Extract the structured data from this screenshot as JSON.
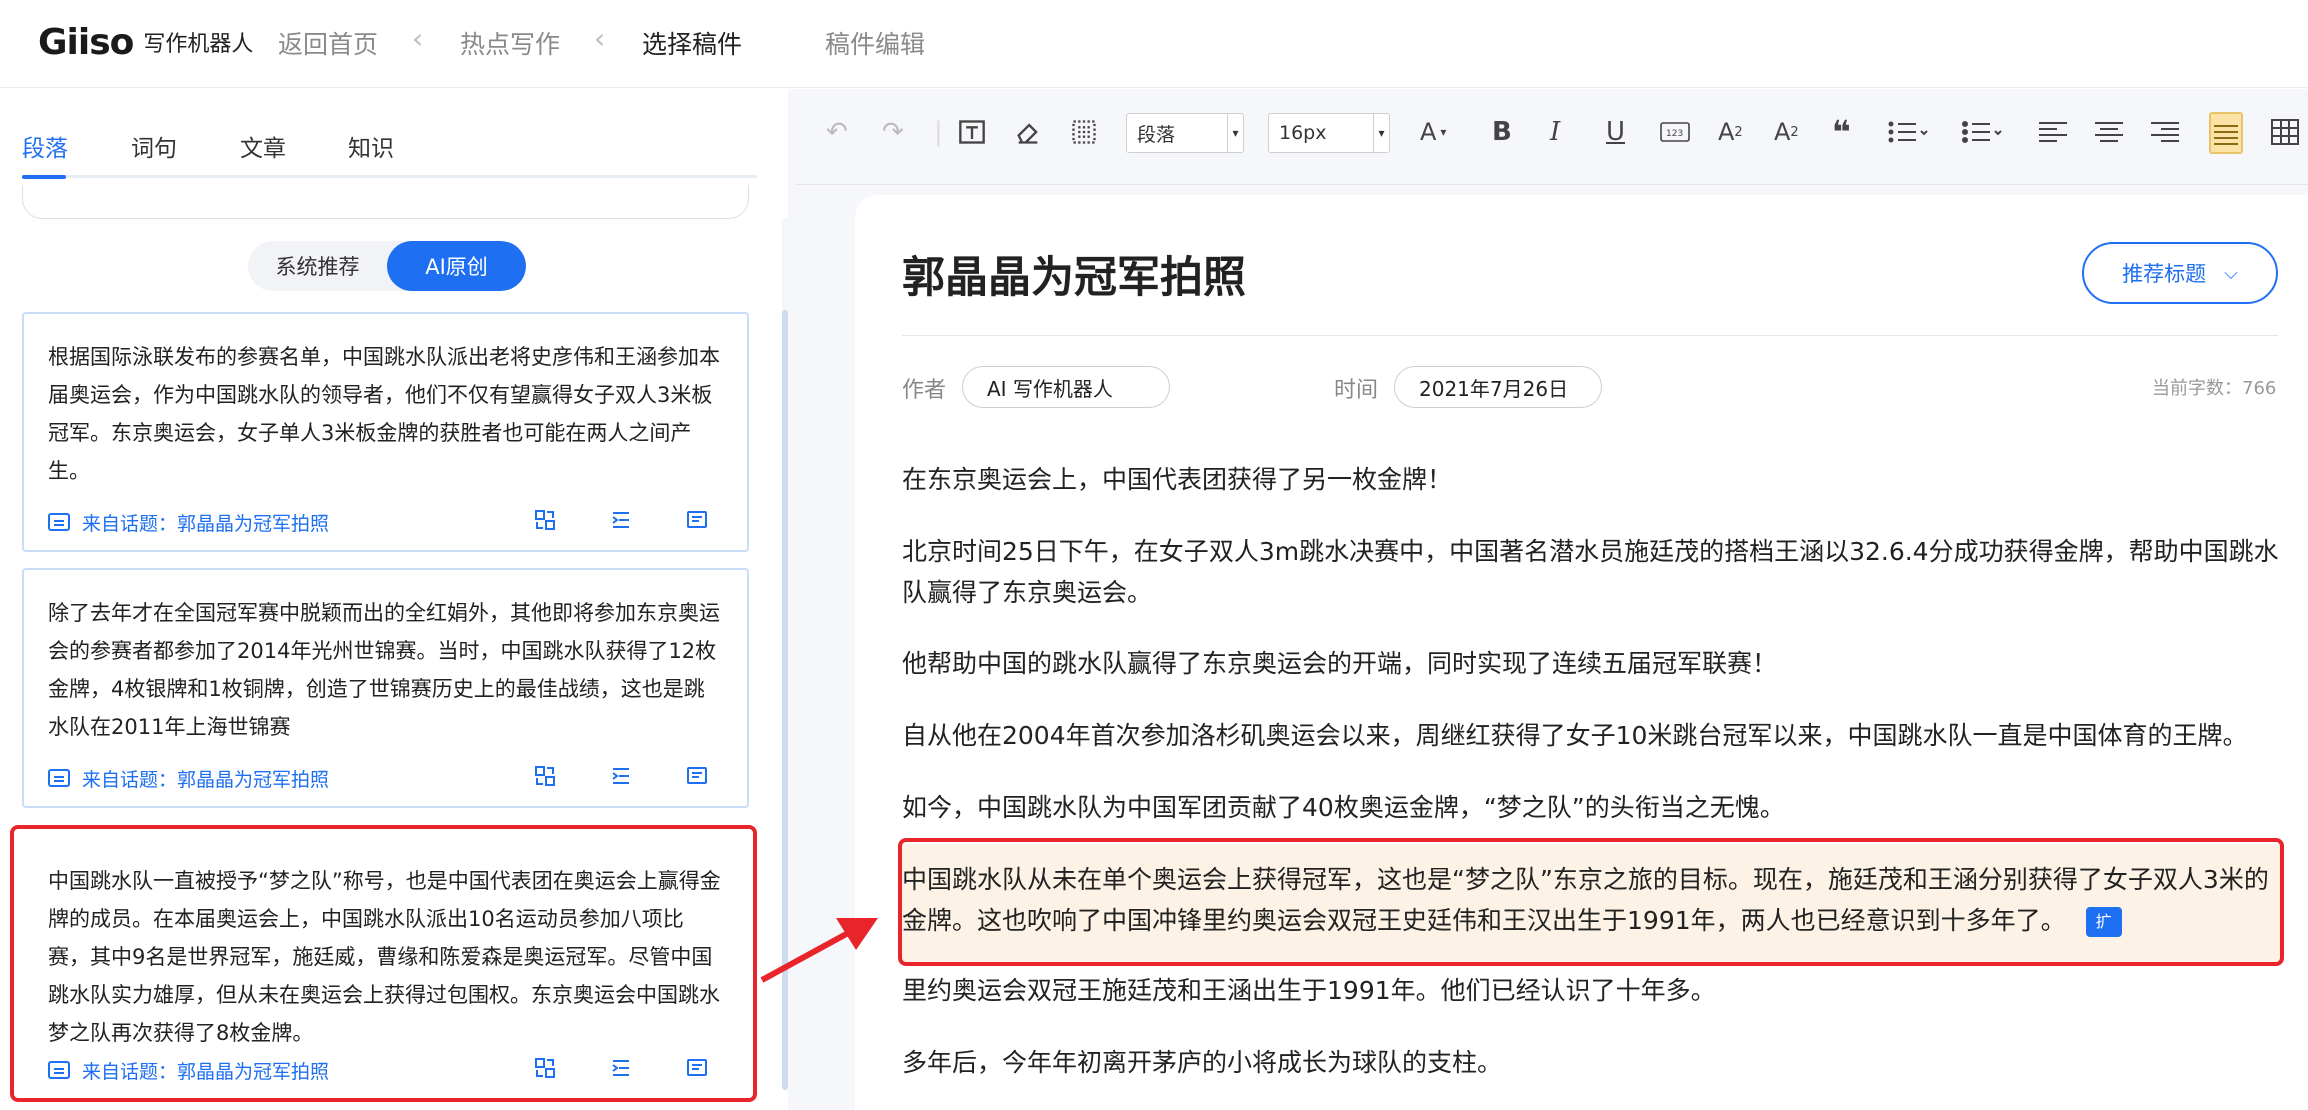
{
  "app": {
    "logo": "Giiso",
    "logo_subtitle": "写作机器人"
  },
  "nav": {
    "home": "返回首页",
    "hot_writing": "热点写作",
    "select_draft": "选择稿件",
    "edit_draft": "稿件编辑"
  },
  "left": {
    "tabs": [
      "段落",
      "词句",
      "文章",
      "知识"
    ],
    "active_tab": "段落",
    "segment": {
      "options": [
        "系统推荐",
        "AI原创"
      ],
      "active": "AI原创"
    },
    "cards": [
      {
        "text": "根据国际泳联发布的参赛名单，中国跳水队派出老将史彦伟和王涵参加本届奥运会，作为中国跳水队的领导者，他们不仅有望赢得女子双人3米板冠军。东京奥运会，女子单人3米板金牌的获胜者也可能在两人之间产生。",
        "source": "来自话题：郭晶晶为冠军拍照"
      },
      {
        "text": "除了去年才在全国冠军赛中脱颖而出的全红娟外，其他即将参加东京奥运会的参赛者都参加了2014年光州世锦赛。当时，中国跳水队获得了12枚金牌，4枚银牌和1枚铜牌，创造了世锦赛历史上的最佳战绩，这也是跳水队在2011年上海世锦赛",
        "source": "来自话题：郭晶晶为冠军拍照"
      },
      {
        "text": "中国跳水队一直被授予“梦之队”称号，也是中国代表团在奥运会上赢得金牌的成员。在本届奥运会上，中国跳水队派出10名运动员参加八项比赛，其中9名是世界冠军，施廷威，曹缘和陈爱森是奥运冠军。尽管中国跳水队实力雄厚，但从未在奥运会上获得过包围权。东京奥运会中国跳水梦之队再次获得了8枚金牌。",
        "source": "来自话题：郭晶晶为冠军拍照"
      }
    ]
  },
  "toolbar": {
    "paragraph_select": "段落",
    "font_size_select": "16px"
  },
  "doc": {
    "title": "郭晶晶为冠军拍照",
    "recommend_title_button": "推荐标题",
    "author_label": "作者",
    "author_value": "AI 写作机器人",
    "time_label": "时间",
    "time_value": "2021年7月26日",
    "word_count": "当前字数：766",
    "paragraphs": [
      "在东京奥运会上，中国代表团获得了另一枚金牌！",
      "北京时间25日下午，在女子双人3m跳水决赛中，中国著名潜水员施廷茂的搭档王涵以32.6.4分成功获得金牌，帮助中国跳水队赢得了东京奥运会。",
      "他帮助中国的跳水队赢得了东京奥运会的开端，同时实现了连续五届冠军联赛！",
      "自从他在2004年首次参加洛杉矶奥运会以来，周继红获得了女子10米跳台冠军以来，中国跳水队一直是中国体育的王牌。",
      "如今，中国跳水队为中国军团贡献了40枚奥运金牌，“梦之队”的头衔当之无愧。",
      "中国跳水队从未在单个奥运会上获得冠军，这也是“梦之队”东京之旅的目标。现在，施廷茂和王涵分别获得了女子双人3米的金牌。这也吹响了中国冲锋里约奥运会双冠王史廷伟和王汉出生于1991年，两人也已经意识到十多年了。",
      "里约奥运会双冠王施廷茂和王涵出生于1991年。他们已经认识了十年多。",
      "多年后，今年年初离开茅庐的小将成长为球队的支柱。"
    ],
    "expand_tag": "扩"
  },
  "colors": {
    "accent": "#1e6ff1",
    "highlight_border": "#e8252a",
    "highlight_bg": "#fdf2e6"
  }
}
